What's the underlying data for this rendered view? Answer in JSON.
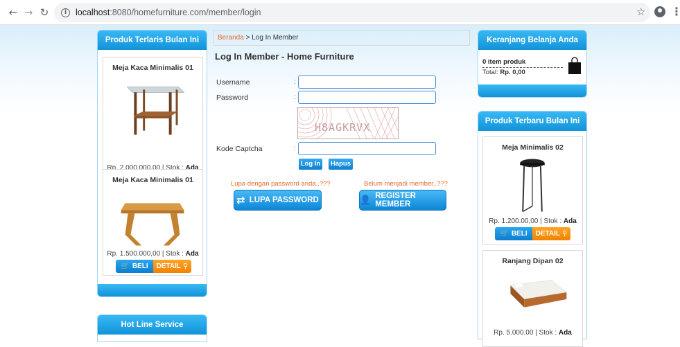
{
  "browser": {
    "url_host": "localhost",
    "url_rest": ":8080/homefurniture.com/member/login"
  },
  "left": {
    "bestseller_title": "Produk Terlaris Bulan Ini",
    "products": [
      {
        "name": "Meja Kaca Minimalis 01",
        "price_prefix": "Rp. 2.000.000,00 | Stok : ",
        "stock": "Ada"
      },
      {
        "name": "Meja Kaca Minimalis 01",
        "price_prefix": "Rp. 1.500.000,00 | Stok : ",
        "stock": "Ada"
      }
    ],
    "hotline_title": "Hot Line Service"
  },
  "buttons": {
    "buy": "BELI",
    "detail": "DETAIL"
  },
  "center": {
    "breadcrumb_home": "Beranda",
    "breadcrumb_sep": " > ",
    "breadcrumb_current": "Log In Member",
    "title": "Log In Member - Home Furniture",
    "username_label": "Username",
    "password_label": "Password",
    "captcha_label": "Kode Captcha",
    "colon": ":",
    "captcha_text": "H8AGKRVX",
    "login_button": "Log In",
    "reset_button": "Hapus",
    "forgot_hint": "Lupa dengan password anda..???",
    "register_hint": "Belum menjadi member..???",
    "forgot_button": "LUPA PASSWORD",
    "register_button": "REGISTER MEMBER"
  },
  "right": {
    "cart_title": "Keranjang Belanja Anda",
    "cart_count": "0 item produk",
    "cart_total_label": "Total: ",
    "cart_total_value": "Rp. 0,00",
    "newest_title": "Produk Terbaru Bulan Ini",
    "products": [
      {
        "name": "Meja Minimalis 02",
        "price_prefix": "Rp. 1.200.00,00 | Stok : ",
        "stock": "Ada"
      },
      {
        "name": "Ranjang Dipan 02",
        "price_prefix": "Rp. 5.000.00 | Stok : ",
        "stock": "Ada"
      }
    ]
  },
  "colors": {
    "accent_blue": "#1293d9",
    "accent_orange": "#f08300",
    "link_orange": "#e86a2a"
  }
}
